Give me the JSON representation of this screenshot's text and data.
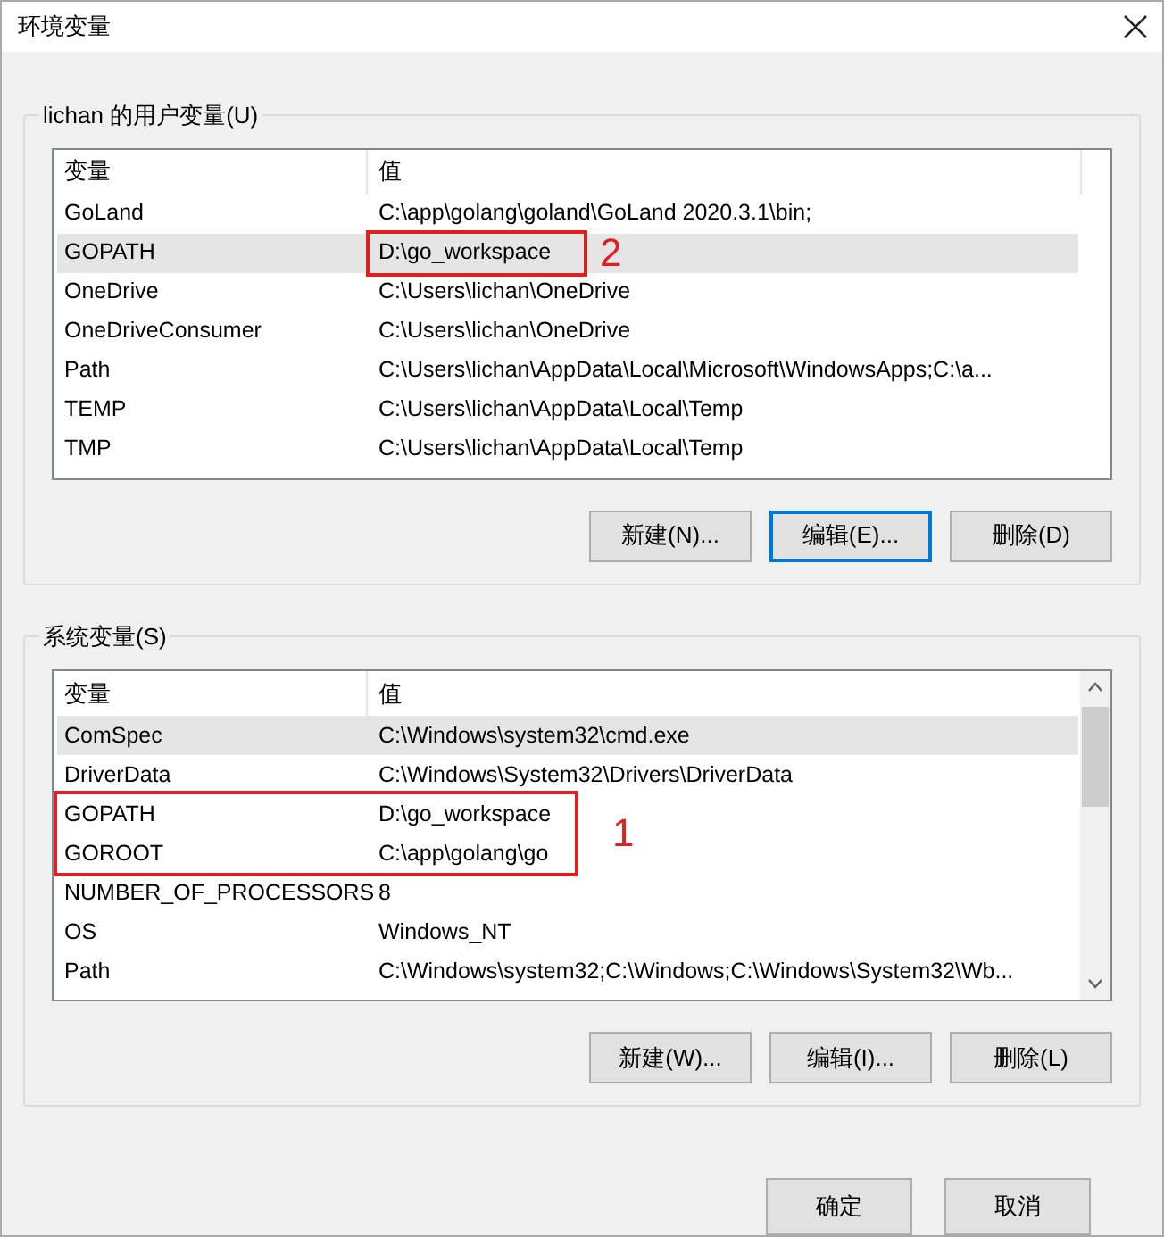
{
  "window": {
    "title": "环境变量"
  },
  "groups": [
    {
      "label": "lichan 的用户变量(U)",
      "columns": [
        "变量",
        "值"
      ],
      "scrollbar": false,
      "mark": {
        "label": "2",
        "kind": "value"
      },
      "rows": [
        {
          "name": "GoLand",
          "value": "C:\\app\\golang\\goland\\GoLand 2020.3.1\\bin;",
          "selected": false,
          "marked": false
        },
        {
          "name": "GOPATH",
          "value": "D:\\go_workspace",
          "selected": true,
          "marked": true
        },
        {
          "name": "OneDrive",
          "value": "C:\\Users\\lichan\\OneDrive",
          "selected": false,
          "marked": false
        },
        {
          "name": "OneDriveConsumer",
          "value": "C:\\Users\\lichan\\OneDrive",
          "selected": false,
          "marked": false
        },
        {
          "name": "Path",
          "value": "C:\\Users\\lichan\\AppData\\Local\\Microsoft\\WindowsApps;C:\\a...",
          "selected": false,
          "marked": false
        },
        {
          "name": "TEMP",
          "value": "C:\\Users\\lichan\\AppData\\Local\\Temp",
          "selected": false,
          "marked": false
        },
        {
          "name": "TMP",
          "value": "C:\\Users\\lichan\\AppData\\Local\\Temp",
          "selected": false,
          "marked": false
        }
      ],
      "buttons": [
        {
          "label": "新建(N)...",
          "focused": false
        },
        {
          "label": "编辑(E)...",
          "focused": true
        },
        {
          "label": "删除(D)",
          "focused": false
        }
      ]
    },
    {
      "label": "系统变量(S)",
      "columns": [
        "变量",
        "值"
      ],
      "scrollbar": true,
      "mark": {
        "label": "1",
        "kind": "row"
      },
      "rows": [
        {
          "name": "ComSpec",
          "value": "C:\\Windows\\system32\\cmd.exe",
          "selected": true,
          "marked": false
        },
        {
          "name": "DriverData",
          "value": "C:\\Windows\\System32\\Drivers\\DriverData",
          "selected": false,
          "marked": false
        },
        {
          "name": "GOPATH",
          "value": "D:\\go_workspace",
          "selected": false,
          "marked": true
        },
        {
          "name": "GOROOT",
          "value": "C:\\app\\golang\\go",
          "selected": false,
          "marked": true
        },
        {
          "name": "NUMBER_OF_PROCESSORS",
          "value": "8",
          "selected": false,
          "marked": false
        },
        {
          "name": "OS",
          "value": "Windows_NT",
          "selected": false,
          "marked": false
        },
        {
          "name": "Path",
          "value": "C:\\Windows\\system32;C:\\Windows;C:\\Windows\\System32\\Wb...",
          "selected": false,
          "marked": false
        }
      ],
      "buttons": [
        {
          "label": "新建(W)...",
          "focused": false
        },
        {
          "label": "编辑(I)...",
          "focused": false
        },
        {
          "label": "删除(L)",
          "focused": false
        }
      ]
    }
  ],
  "footer_buttons": [
    {
      "label": "确定",
      "focused": false
    },
    {
      "label": "取消",
      "focused": false
    }
  ]
}
